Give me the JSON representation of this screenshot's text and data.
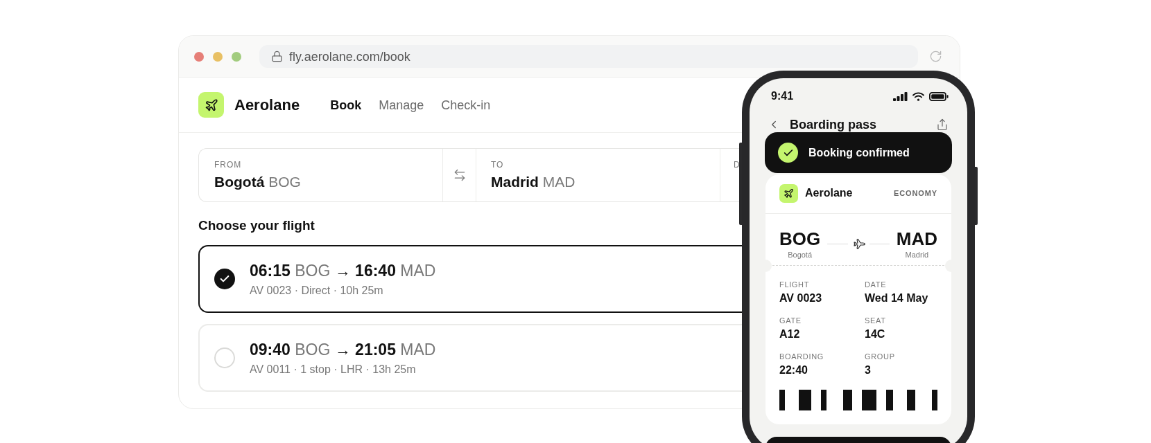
{
  "browser": {
    "url": "fly.aerolane.com/book"
  },
  "app": {
    "brand": "Aerolane",
    "nav": [
      {
        "label": "Book",
        "selected": true
      },
      {
        "label": "Manage",
        "selected": false
      },
      {
        "label": "Check-in",
        "selected": false
      }
    ]
  },
  "route": {
    "from": {
      "label": "FROM",
      "value": "**Bogotá** BOG"
    },
    "to": {
      "label": "TO",
      "value": "**Madrid** MAD"
    },
    "column_3": {
      "label": "D"
    }
  },
  "flights": {
    "title": "Choose your flight",
    "options": [
      {
        "times": "**06:15** BOG **→ 16:40** MAD",
        "details": "AV 0023 · Direct · 10h 25m",
        "selected": true
      },
      {
        "times": "**09:40** BOG **→ 21:05** MAD",
        "details": "AV 0011 · 1 stop · LHR · 13h 25m",
        "selected": false
      }
    ]
  },
  "phone": {
    "time": "9:41",
    "title": "Boarding pass",
    "toast": "Booking confirmed",
    "pass": {
      "brand": "Aerolane",
      "cabin": "ECONOMY",
      "origin": {
        "code": "BOG",
        "city": "Bogotá"
      },
      "destination": {
        "code": "MAD",
        "city": "Madrid"
      },
      "details": [
        {
          "label": "FLIGHT",
          "value": "AV 0023"
        },
        {
          "label": "DATE",
          "value": "Wed 14 May"
        },
        {
          "label": "GATE",
          "value": "A12"
        },
        {
          "label": "SEAT",
          "value": "14C"
        },
        {
          "label": "BOARDING",
          "value": "22:40"
        },
        {
          "label": "GROUP",
          "value": "3"
        }
      ]
    }
  }
}
